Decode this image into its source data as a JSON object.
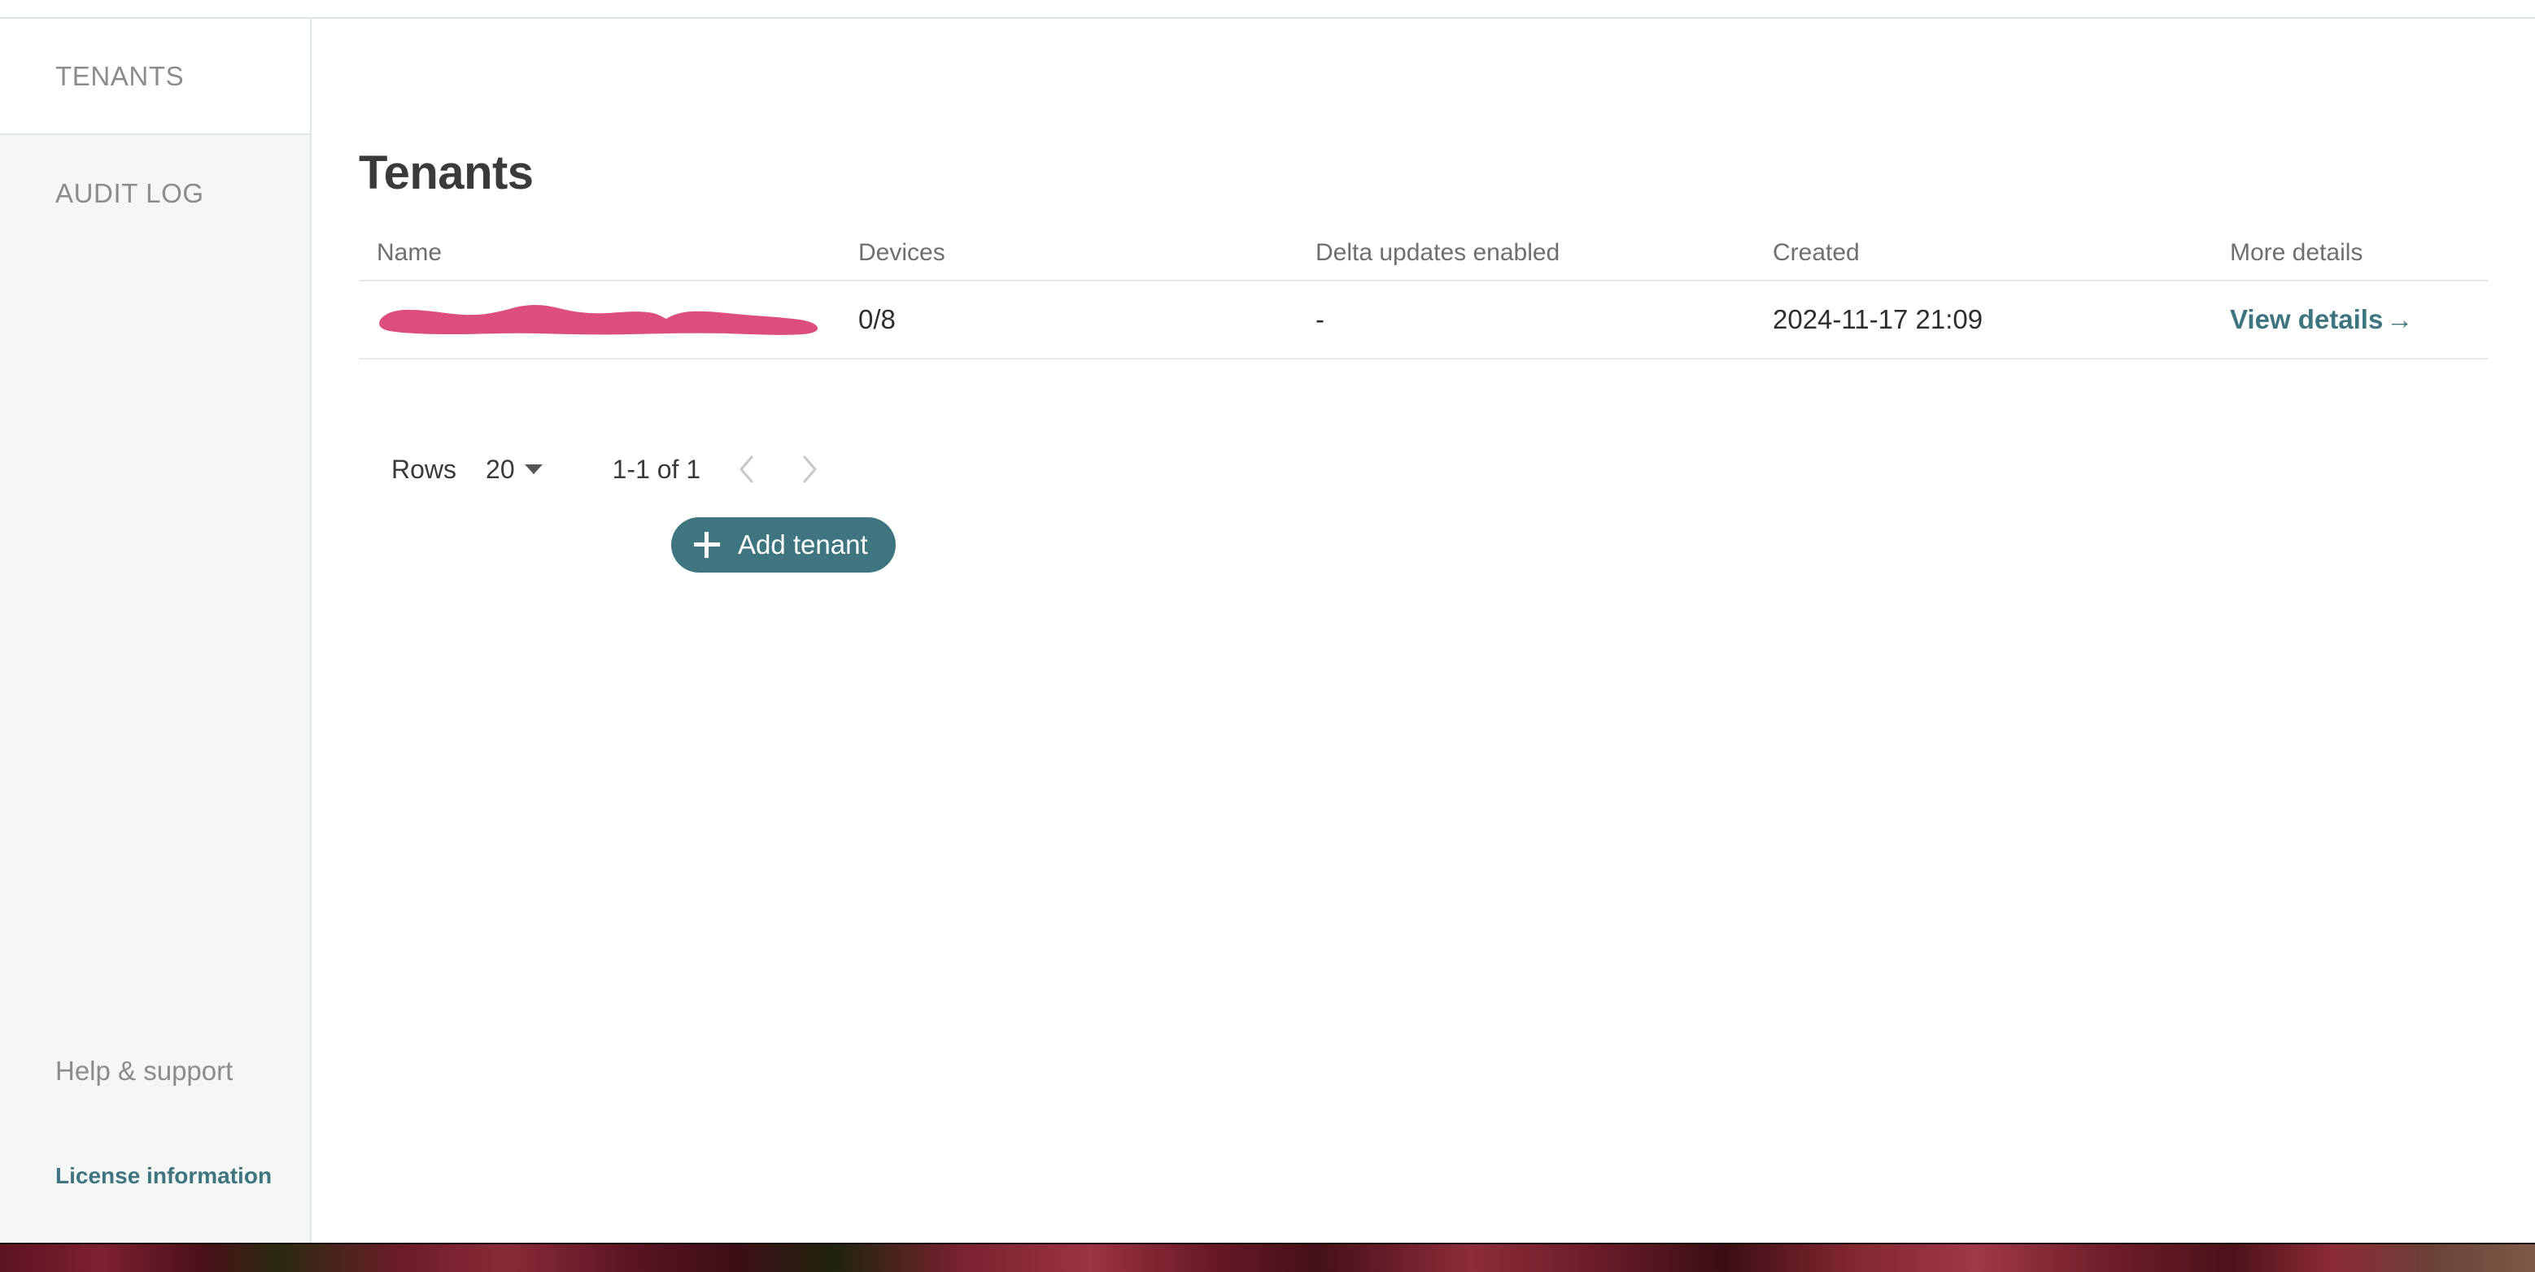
{
  "sidebar": {
    "items": [
      {
        "label": "TENANTS",
        "active": true
      },
      {
        "label": "AUDIT LOG",
        "active": false
      }
    ],
    "bottom": {
      "help_label": "Help & support",
      "license_label": "License information"
    }
  },
  "main": {
    "page_title": "Tenants",
    "table": {
      "columns": [
        "Name",
        "Devices",
        "Delta updates enabled",
        "Created",
        "More details"
      ],
      "rows": [
        {
          "name": "",
          "name_redacted": true,
          "devices": "0/8",
          "delta_updates_enabled": "-",
          "created": "2024-11-17 21:09",
          "more_details_label": "View details",
          "more_details_arrow": "→"
        }
      ]
    },
    "pagination": {
      "rows_label": "Rows",
      "rows_per_page": "20",
      "range_label": "1-1 of 1",
      "prev_enabled": false,
      "next_enabled": false
    },
    "add_button": {
      "label": "Add tenant",
      "icon": "plus-icon"
    }
  },
  "colors": {
    "accent_teal": "#3e7580",
    "redaction_pink": "#db4e7d",
    "sidebar_bg": "#f5f6f6",
    "divider_teal": "#dbe7e7",
    "table_divider": "#e6e6e6",
    "text_muted": "#8c8c8c",
    "text_dark": "#2e2e2e"
  }
}
